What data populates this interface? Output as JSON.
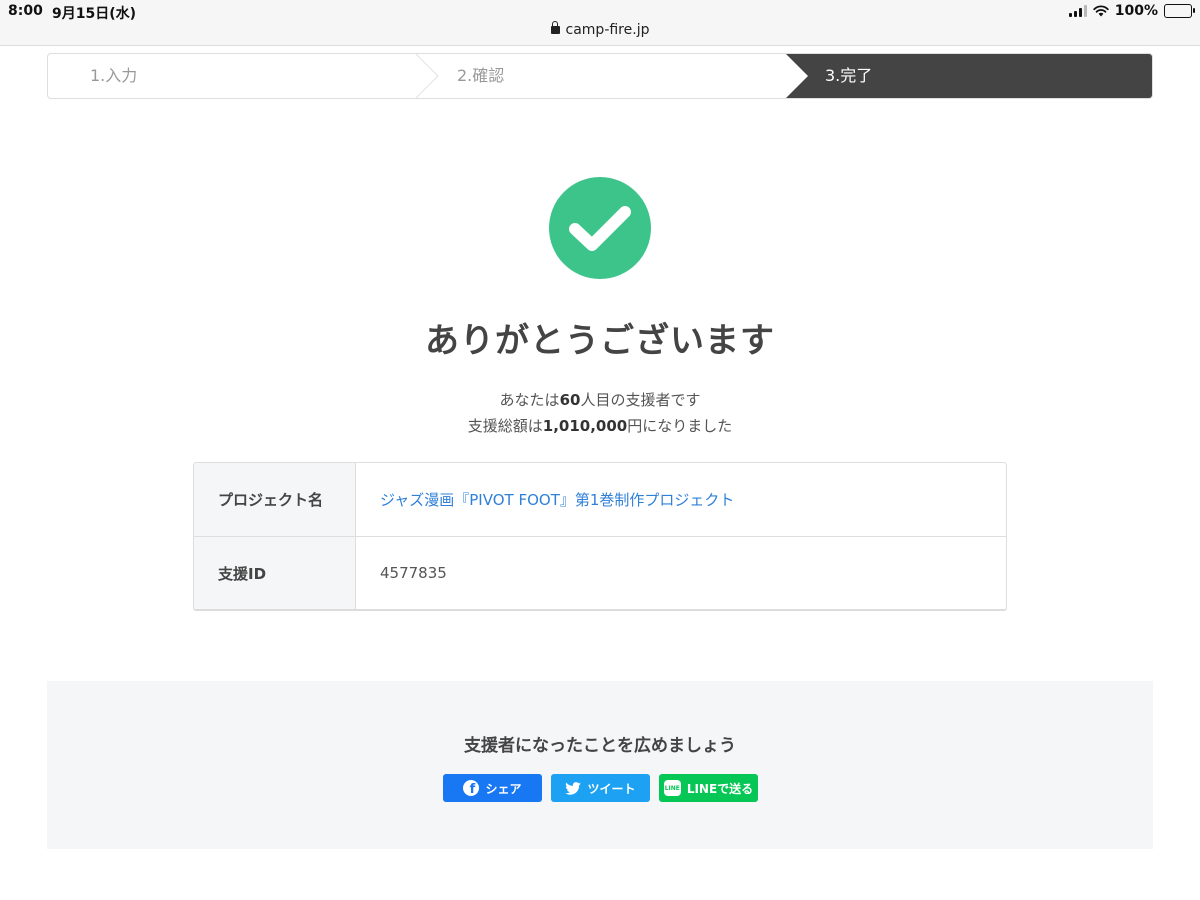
{
  "status": {
    "time": "8:00",
    "date": "9月15日(水)",
    "battery": "100%",
    "battery_level": 1.0
  },
  "browser": {
    "url": "camp-fire.jp",
    "lock_icon": "lock-icon"
  },
  "steps": [
    {
      "label": "1.入力",
      "active": false
    },
    {
      "label": "2.確認",
      "active": false
    },
    {
      "label": "3.完了",
      "active": true
    }
  ],
  "result": {
    "icon": "check-circle-icon",
    "icon_color": "#3dc48a",
    "title": "ありがとうございます",
    "line1_pre": "あなたは",
    "line1_count": "60",
    "line1_post": "人目の支援者です",
    "line2_pre": "支援総額は",
    "line2_amount": "1,010,000",
    "line2_post": "円になりました"
  },
  "table": {
    "rows": [
      {
        "label": "プロジェクト名",
        "value": "ジャズ漫画『PIVOT FOOT』第1巻制作プロジェクト",
        "link": true
      },
      {
        "label": "支援ID",
        "value": "4577835",
        "link": false
      }
    ]
  },
  "share": {
    "title": "支援者になったことを広めましょう",
    "buttons": [
      {
        "label": "シェア",
        "icon": "facebook-icon",
        "color": "#1877f2"
      },
      {
        "label": "ツイート",
        "icon": "twitter-icon",
        "color": "#1da1f2"
      },
      {
        "label": "LINEで送る",
        "icon": "line-icon",
        "color": "#06c755"
      }
    ]
  }
}
